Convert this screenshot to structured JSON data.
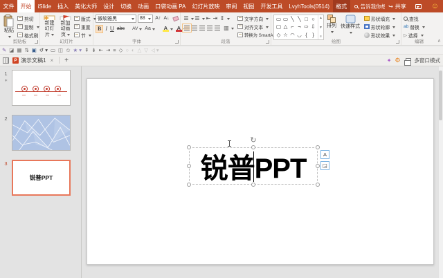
{
  "titlebar": {
    "tabs": [
      "文件",
      "开始",
      "iSlide",
      "插入",
      "美化大师",
      "设计",
      "切换",
      "动画",
      "口袋动画 PA",
      "幻灯片放映",
      "审阅",
      "视图",
      "开发工具",
      "LvyhTools(0514)",
      "格式"
    ],
    "search_placeholder": "告诉我你想要做什么",
    "share_label": "共享"
  },
  "ribbon": {
    "clipboard": {
      "label": "剪贴板",
      "paste": "粘贴",
      "cut": "剪切",
      "copy": "复制",
      "format_painter": "格式刷"
    },
    "slides": {
      "label": "幻灯片",
      "new_slide_line1": "新建",
      "new_slide_line2": "幻灯片",
      "new_anim_line1": "新加",
      "new_anim_line2": "动画页",
      "layout": "版式",
      "reset": "重置",
      "section": "节"
    },
    "font": {
      "label": "字体",
      "name": "微软雅黑",
      "size": "88"
    },
    "paragraph": {
      "label": "段落",
      "text_direction": "文字方向",
      "align_text": "对齐文本",
      "smartart": "转换为 SmartArt"
    },
    "drawing": {
      "label": "绘图",
      "arrange": "排列",
      "quick_styles": "快速样式",
      "shape_fill": "形状填充",
      "shape_outline": "形状轮廓",
      "shape_effects": "形状效果",
      "shape_rows": [
        [
          "▭",
          "▭",
          "╲",
          "╲",
          "□",
          "○"
        ],
        [
          "▢",
          "△",
          "⌐",
          "¬",
          "⇨",
          "⇩"
        ],
        [
          "◇",
          "☆",
          "◠",
          "◡",
          "{",
          "}"
        ]
      ]
    },
    "editing": {
      "label": "编辑",
      "find": "查找",
      "replace": "替换",
      "select": "选择"
    }
  },
  "qat": {
    "icons": [
      "✎",
      "◪",
      "▦",
      "⇅",
      "▣",
      "↺ ▾",
      "▭",
      "◫",
      "✩",
      "★ ▾",
      "⇞",
      "⇟",
      "⇤",
      "⇥",
      "≡",
      "◇",
      "○",
      "◐",
      "△",
      "▽",
      "◁ ▾"
    ]
  },
  "doctabs": {
    "title": "演示文稿1",
    "close": "×",
    "add": "+",
    "multi_window": "多窗口模式"
  },
  "slide_panel": {
    "slide1_num": "1",
    "slide2_num": "2",
    "slide3_num": "3",
    "slide3_text": "锐普PPT",
    "animation_star": "∗"
  },
  "canvas": {
    "text": "锐普PPT"
  },
  "icons": {
    "bold": "B",
    "italic": "I",
    "underline": "U",
    "strike": "abc",
    "spacing": "AV",
    "case_toggle": "Aa",
    "grow_font": "A↑",
    "shrink_font": "A↓",
    "highlight_a": "A",
    "font_color_a": "A",
    "bullets": "☰",
    "numbering": "☰",
    "outdent": "⇤",
    "indent": "⇥",
    "line_spacing": "⇕",
    "columns": "▥",
    "scroll_up": "▲",
    "scroll_down": "▼",
    "gallery_more": "≡",
    "replace_ab": "ab",
    "select_cursor": "▷",
    "collapse_ribbon": "∧",
    "share_arrow": "↪",
    "wand": "✦",
    "gear": "⚙",
    "smiley": "☺",
    "rotate_handle": "↻",
    "mini_a": "A",
    "mini_arrow": "◲"
  },
  "colors": {
    "brand": "#BD4B27",
    "contextual_tab": "#A03A1E",
    "selected_slide_border": "#E8775A",
    "slide2_bg": "#AFC3E4"
  }
}
